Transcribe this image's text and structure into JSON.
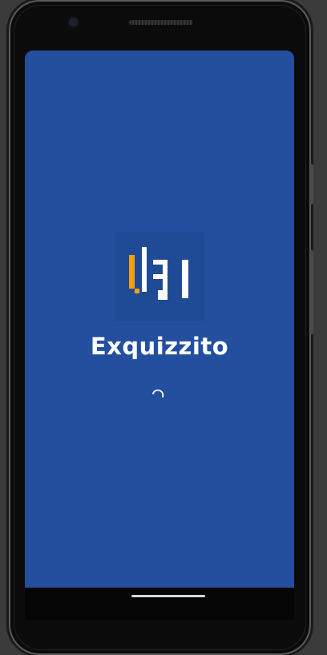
{
  "app": {
    "name": "Exquizzito"
  },
  "icons": {
    "logo": "exquizzito-logo-icon",
    "spinner": "loading-spinner-icon"
  },
  "colors": {
    "splash_background": "#234f9e",
    "logo_tile": "#1f4a95",
    "accent_orange": "#f2a20c",
    "text": "#ffffff"
  }
}
